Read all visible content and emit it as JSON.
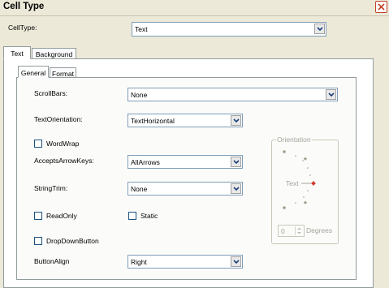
{
  "window": {
    "title": "Cell Type"
  },
  "celltype": {
    "label": "CellType:",
    "value": "Text"
  },
  "outer_tabs": [
    "Text",
    "Background"
  ],
  "inner_tabs": [
    "General",
    "Format"
  ],
  "general": {
    "scrollbars": {
      "label": "ScrollBars:",
      "value": "None"
    },
    "text_orientation": {
      "label": "TextOrientation:",
      "value": "TextHorizontal"
    },
    "wordwrap": {
      "label": "WordWrap",
      "checked": false
    },
    "accepts_arrow_keys": {
      "label": "AcceptsArrowKeys:",
      "value": "AllArrows"
    },
    "string_trim": {
      "label": "StringTrim:",
      "value": "None"
    },
    "readonly": {
      "label": "ReadOnly",
      "checked": false
    },
    "static": {
      "label": "Static",
      "checked": false
    },
    "dropdown_button": {
      "label": "DropDownButton",
      "checked": false
    },
    "button_align": {
      "label": "ButtonAlign",
      "value": "Right"
    }
  },
  "orientation": {
    "title": "Orientation",
    "dial_label": "Text",
    "degrees_value": "0",
    "degrees_label": "Degrees"
  }
}
